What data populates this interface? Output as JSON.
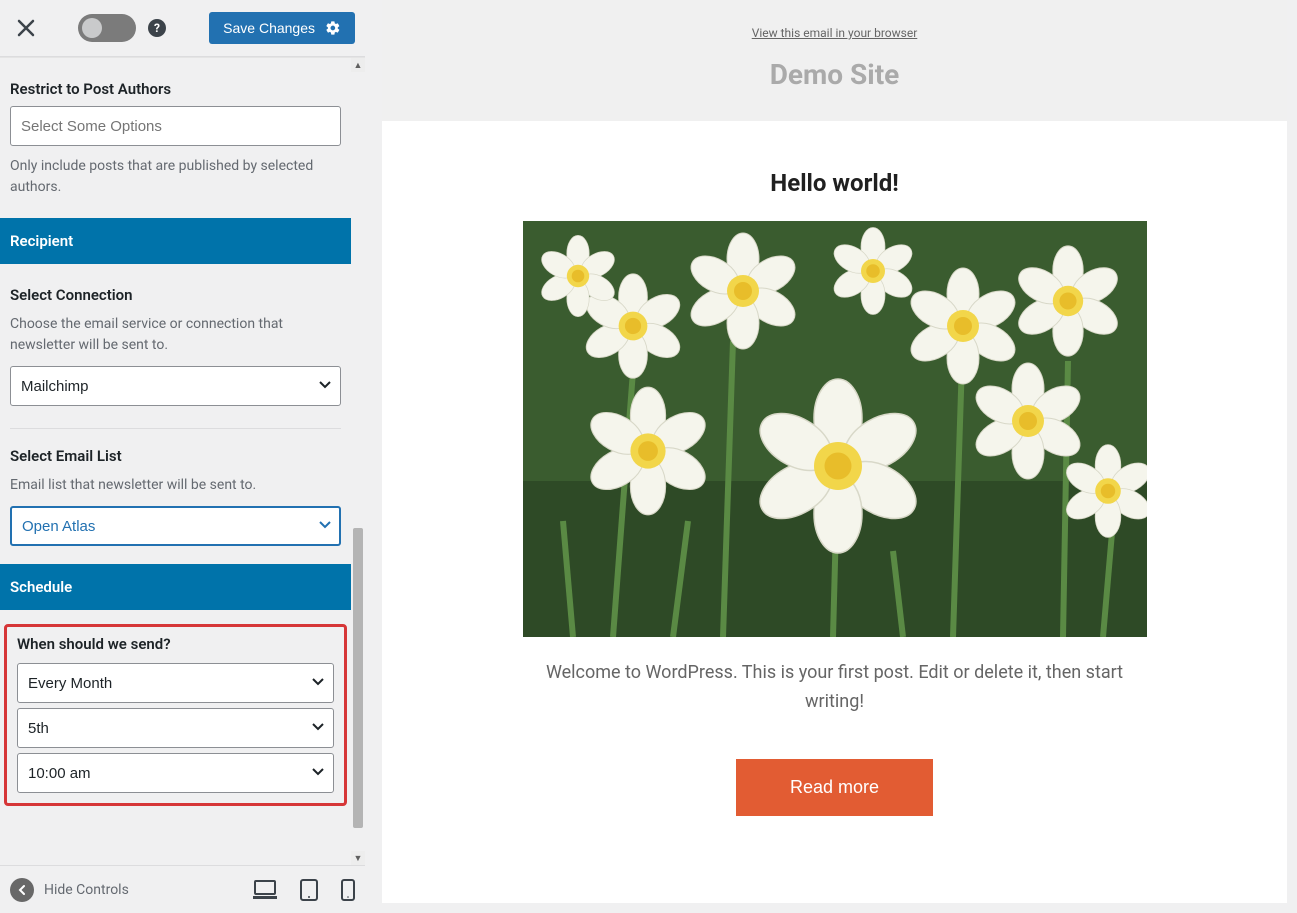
{
  "topbar": {
    "save_label": "Save Changes"
  },
  "restrict": {
    "heading": "Restrict to Post Authors",
    "placeholder": "Select Some Options",
    "hint": "Only include posts that are published by selected authors."
  },
  "panels": {
    "recipient": "Recipient",
    "schedule": "Schedule"
  },
  "connection": {
    "heading": "Select Connection",
    "hint": "Choose the email service or connection that newsletter will be sent to.",
    "value": "Mailchimp"
  },
  "email_list": {
    "heading": "Select Email List",
    "hint": "Email list that newsletter will be sent to.",
    "value": "Open Atlas"
  },
  "schedule": {
    "heading": "When should we send?",
    "freq": "Every Month",
    "day": "5th",
    "time": "10:00 am"
  },
  "bottombar": {
    "hide_label": "Hide Controls"
  },
  "preview": {
    "view_link": "View this email in your browser",
    "site_title": "Demo Site",
    "post_title": "Hello world!",
    "post_text": "Welcome to WordPress. This is your first post. Edit or delete it, then start writing!",
    "read_more": "Read more"
  }
}
